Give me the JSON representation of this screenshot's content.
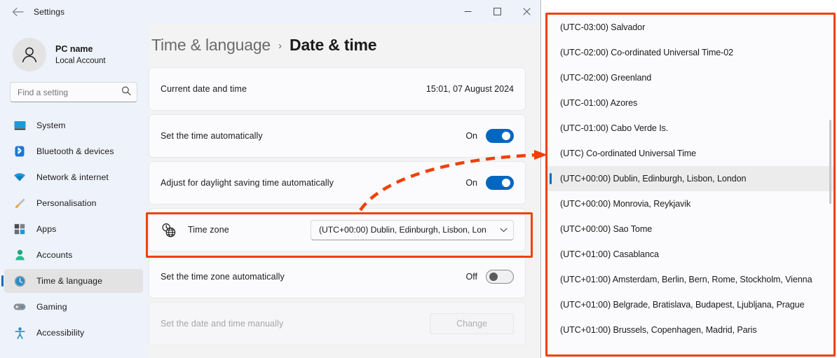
{
  "window": {
    "title": "Settings",
    "back_icon": "back-arrow-icon",
    "controls": {
      "minimize": "minimize-icon",
      "maximize": "maximize-icon",
      "close": "close-icon"
    }
  },
  "sidebar": {
    "profile": {
      "name": "PC name",
      "account": "Local Account",
      "avatar_icon": "person-avatar-icon"
    },
    "search": {
      "placeholder": "Find a setting",
      "value": "",
      "icon": "search-icon"
    },
    "items": [
      {
        "label": "System",
        "icon": "monitor-icon",
        "selected": false
      },
      {
        "label": "Bluetooth & devices",
        "icon": "bluetooth-icon",
        "selected": false
      },
      {
        "label": "Network & internet",
        "icon": "wifi-icon",
        "selected": false
      },
      {
        "label": "Personalisation",
        "icon": "paintbrush-icon",
        "selected": false
      },
      {
        "label": "Apps",
        "icon": "apps-grid-icon",
        "selected": false
      },
      {
        "label": "Accounts",
        "icon": "person-icon",
        "selected": false
      },
      {
        "label": "Time & language",
        "icon": "clock-icon",
        "selected": true
      },
      {
        "label": "Gaming",
        "icon": "gamepad-icon",
        "selected": false
      },
      {
        "label": "Accessibility",
        "icon": "accessibility-icon",
        "selected": false
      }
    ]
  },
  "main": {
    "breadcrumb": {
      "parent": "Time & language",
      "separator": "›",
      "current": "Date & time"
    },
    "rows": {
      "current_date_time": {
        "label": "Current date and time",
        "value": "15:01, 07 August 2024"
      },
      "set_time_automatically": {
        "label": "Set the time automatically",
        "state": "On"
      },
      "daylight_saving": {
        "label": "Adjust for daylight saving time automatically",
        "state": "On"
      },
      "time_zone": {
        "label": "Time zone",
        "icon": "time-zone-globe-clock-icon",
        "value": "(UTC+00:00) Dublin, Edinburgh, Lisbon, Lon",
        "chevron_icon": "chevron-down-icon"
      },
      "set_time_zone_automatically": {
        "label": "Set the time zone automatically",
        "state": "Off"
      },
      "set_manually": {
        "label": "Set the date and time manually",
        "button": "Change"
      }
    }
  },
  "dropdown": {
    "items": [
      {
        "label": "(UTC-03:00) Salvador",
        "selected": false
      },
      {
        "label": "(UTC-02:00) Co-ordinated Universal Time-02",
        "selected": false
      },
      {
        "label": "(UTC-02:00) Greenland",
        "selected": false
      },
      {
        "label": "(UTC-01:00) Azores",
        "selected": false
      },
      {
        "label": "(UTC-01:00) Cabo Verde Is.",
        "selected": false
      },
      {
        "label": "(UTC) Co-ordinated Universal Time",
        "selected": false
      },
      {
        "label": "(UTC+00:00) Dublin, Edinburgh, Lisbon, London",
        "selected": true
      },
      {
        "label": "(UTC+00:00) Monrovia, Reykjavik",
        "selected": false
      },
      {
        "label": "(UTC+00:00) Sao Tome",
        "selected": false
      },
      {
        "label": "(UTC+01:00) Casablanca",
        "selected": false
      },
      {
        "label": "(UTC+01:00) Amsterdam, Berlin, Bern, Rome, Stockholm, Vienna",
        "selected": false
      },
      {
        "label": "(UTC+01:00) Belgrade, Bratislava, Budapest, Ljubljana, Prague",
        "selected": false
      },
      {
        "label": "(UTC+01:00) Brussels, Copenhagen, Madrid, Paris",
        "selected": false
      }
    ]
  },
  "annotations": {
    "highlight_color": "#f04007",
    "arrow_icon": "dashed-curved-arrow"
  },
  "colors": {
    "accent": "#0067c0",
    "selection_bar": "#0f6cbd",
    "highlight": "#f04007",
    "sidebar_bg": "#eef2fa",
    "card_bg": "#fbfbfd"
  }
}
